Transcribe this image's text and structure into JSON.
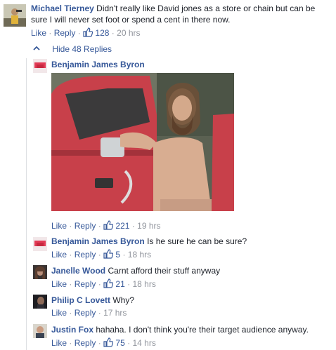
{
  "colors": {
    "link": "#365899",
    "muted": "#90949c",
    "text": "#1d2129",
    "line": "#dddfe2"
  },
  "top_comment": {
    "author": "Michael Tierney",
    "text_line1": "Didn't really like David jones as a store or chain but can be",
    "text_line2": "sure I will never set foot or spend a cent in there now.",
    "like": "Like",
    "reply": "Reply",
    "likes": "128",
    "time": "20 hrs"
  },
  "hide_replies": {
    "icon": "chevron-up-icon",
    "label": "Hide 48 Replies"
  },
  "replies": [
    {
      "author": "Benjamin James Byron",
      "text": "",
      "photo": "man-leaning-on-red-truck",
      "like": "Like",
      "reply": "Reply",
      "likes": "221",
      "time": "19 hrs"
    },
    {
      "author": "Benjamin James Byron",
      "text": "Is he sure he can be sure?",
      "like": "Like",
      "reply": "Reply",
      "likes": "5",
      "time": "18 hrs"
    },
    {
      "author": "Janelle Wood",
      "text": "Carnt afford their stuff anyway",
      "like": "Like",
      "reply": "Reply",
      "likes": "21",
      "time": "18 hrs"
    },
    {
      "author": "Philip C Lovett",
      "text": "Why?",
      "like": "Like",
      "reply": "Reply",
      "likes": "",
      "time": "17 hrs"
    },
    {
      "author": "Justin Fox",
      "text": "hahaha. I don't think you're their target audience anyway.",
      "like": "Like",
      "reply": "Reply",
      "likes": "75",
      "time": "14 hrs"
    }
  ]
}
